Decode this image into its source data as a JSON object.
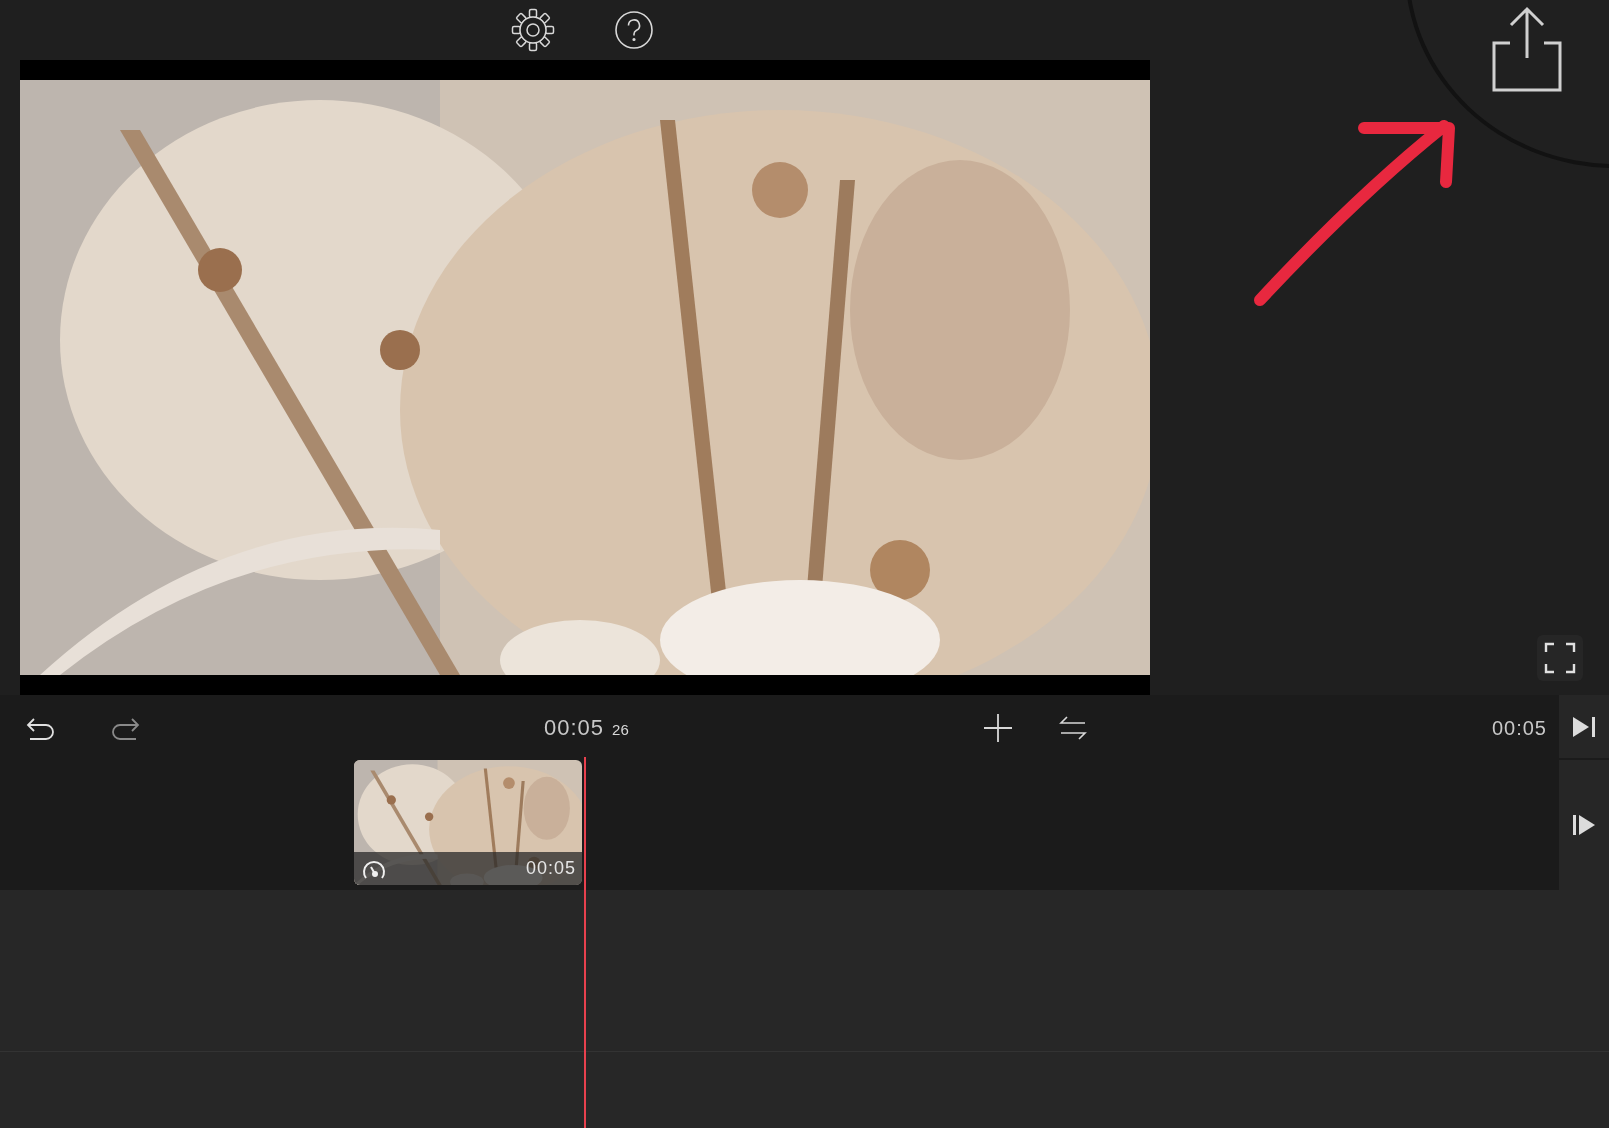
{
  "history_buttons": [
    {
      "kind": "undo",
      "disabled": false
    },
    {
      "kind": "redo",
      "disabled": true
    }
  ],
  "timecode": {
    "current": "00:05",
    "frames": "26"
  },
  "total_duration": "00:05",
  "clip": {
    "duration": "00:05"
  }
}
